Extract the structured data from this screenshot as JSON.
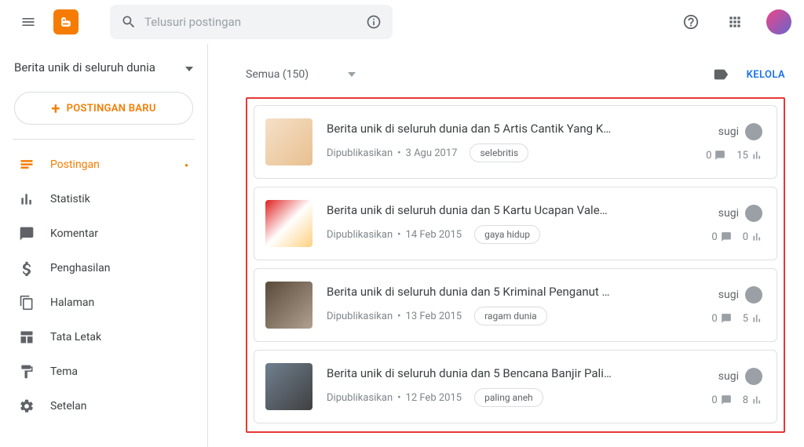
{
  "search": {
    "placeholder": "Telusuri postingan"
  },
  "sidebar": {
    "blog_name": "Berita unik di seluruh dunia",
    "new_post": "POSTINGAN BARU",
    "items": [
      {
        "label": "Postingan",
        "active": true,
        "icon": "post"
      },
      {
        "label": "Statistik",
        "active": false,
        "icon": "stats"
      },
      {
        "label": "Komentar",
        "active": false,
        "icon": "comments"
      },
      {
        "label": "Penghasilan",
        "active": false,
        "icon": "dollar"
      },
      {
        "label": "Halaman",
        "active": false,
        "icon": "pages"
      },
      {
        "label": "Tata Letak",
        "active": false,
        "icon": "layout"
      },
      {
        "label": "Tema",
        "active": false,
        "icon": "theme"
      },
      {
        "label": "Setelan",
        "active": false,
        "icon": "settings"
      }
    ]
  },
  "main": {
    "filter": "Semua (150)",
    "manage": "KELOLA",
    "posts": [
      {
        "title": "Berita unik di seluruh dunia dan 5 Artis Cantik Yang K…",
        "status": "Dipublikasikan",
        "date": "3 Agu 2017",
        "tag": "selebritis",
        "author": "sugi",
        "comments": 0,
        "views": 15,
        "thumb_bg": "linear-gradient(135deg,#f5e0c8,#e8c090)"
      },
      {
        "title": "Berita unik di seluruh dunia dan 5 Kartu Ucapan Vale…",
        "status": "Dipublikasikan",
        "date": "14 Feb 2015",
        "tag": "gaya hidup",
        "author": "sugi",
        "comments": 0,
        "views": 0,
        "thumb_bg": "linear-gradient(135deg,#e02020,#fff 50%,#ffd080)"
      },
      {
        "title": "Berita unik di seluruh dunia dan 5 Kriminal Penganut …",
        "status": "Dipublikasikan",
        "date": "13 Feb 2015",
        "tag": "ragam dunia",
        "author": "sugi",
        "comments": 0,
        "views": 5,
        "thumb_bg": "linear-gradient(135deg,#5a4a3a,#b0a090)"
      },
      {
        "title": "Berita unik di seluruh dunia dan 5 Bencana Banjir Pali…",
        "status": "Dipublikasikan",
        "date": "12 Feb 2015",
        "tag": "paling aneh",
        "author": "sugi",
        "comments": 0,
        "views": 8,
        "thumb_bg": "linear-gradient(135deg,#708090,#404040)"
      }
    ]
  }
}
